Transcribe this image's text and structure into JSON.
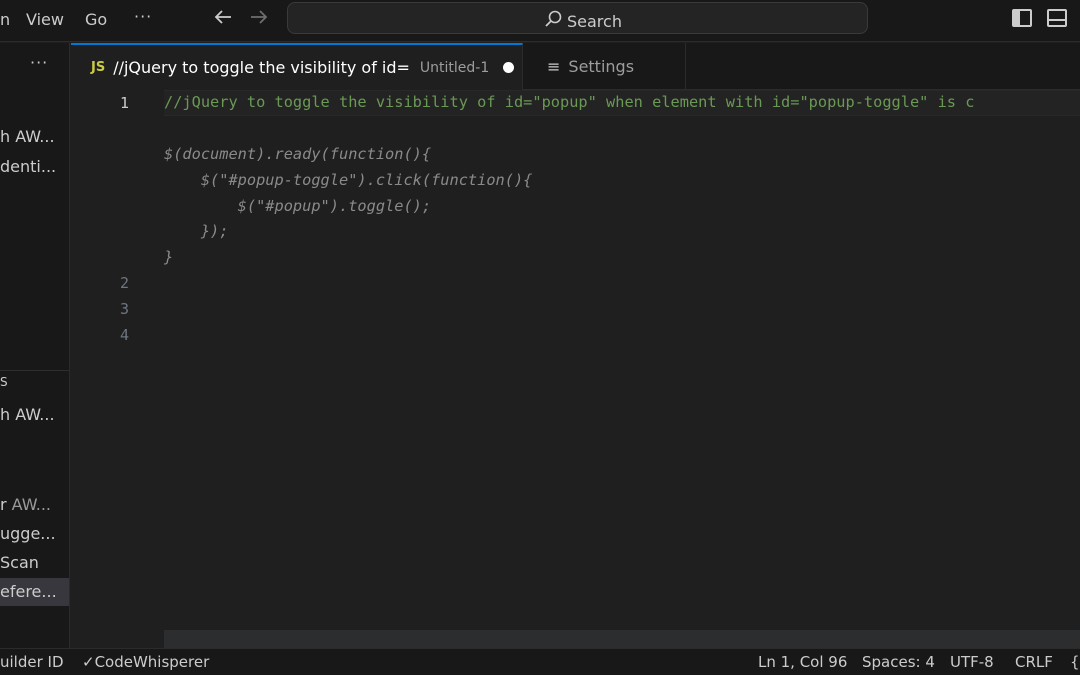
{
  "titlebar": {
    "menu": [
      "n",
      "View",
      "Go",
      "···"
    ],
    "back_icon": "arrow-left-icon",
    "forward_icon": "arrow-right-icon",
    "search": {
      "icon": "search-icon",
      "label": "Search"
    },
    "layout_icons": [
      "toggle-primary-sidebar-icon",
      "toggle-panel-icon"
    ]
  },
  "sidebar": {
    "more_label": "···",
    "items": [
      {
        "label": "h AW...",
        "dim_suffix": ""
      },
      {
        "label": "denti...",
        "dim_suffix": ""
      },
      {
        "label": "S",
        "dim_suffix": ""
      },
      {
        "label": "h AW...",
        "dim_suffix": ""
      },
      {
        "label": "r ",
        "dim_suffix": "AW..."
      },
      {
        "label": "ugge...",
        "dim_suffix": ""
      },
      {
        "label": "Scan",
        "dim_suffix": ""
      },
      {
        "label": "efere...",
        "dim_suffix": "",
        "selected": true
      }
    ]
  },
  "tabs": [
    {
      "badge": "JS",
      "title": "//jQuery to toggle the visibility of id=",
      "description": "Untitled-1",
      "dirty": true,
      "active": true
    },
    {
      "icon": "settings-list-icon",
      "icon_glyph": "≡",
      "title": "Settings",
      "active": false
    }
  ],
  "editor": {
    "line_numbers": [
      "1",
      "2",
      "3",
      "4"
    ],
    "comment_line": "//jQuery to toggle the visibility of id=\"popup\" when element with id=\"popup-toggle\" is c",
    "suggestion_lines": [
      "",
      "$(document).ready(function(){",
      "    $(\"#popup-toggle\").click(function(){",
      "        $(\"#popup\").toggle();",
      "    });",
      "}"
    ]
  },
  "statusbar": {
    "left": [
      {
        "label": "uilder ID"
      },
      {
        "label": "✓CodeWhisperer"
      }
    ],
    "right": [
      {
        "label": "Ln 1, Col 96"
      },
      {
        "label": "Spaces: 4"
      },
      {
        "label": "UTF-8"
      },
      {
        "label": "CRLF"
      },
      {
        "label": "{"
      }
    ]
  }
}
